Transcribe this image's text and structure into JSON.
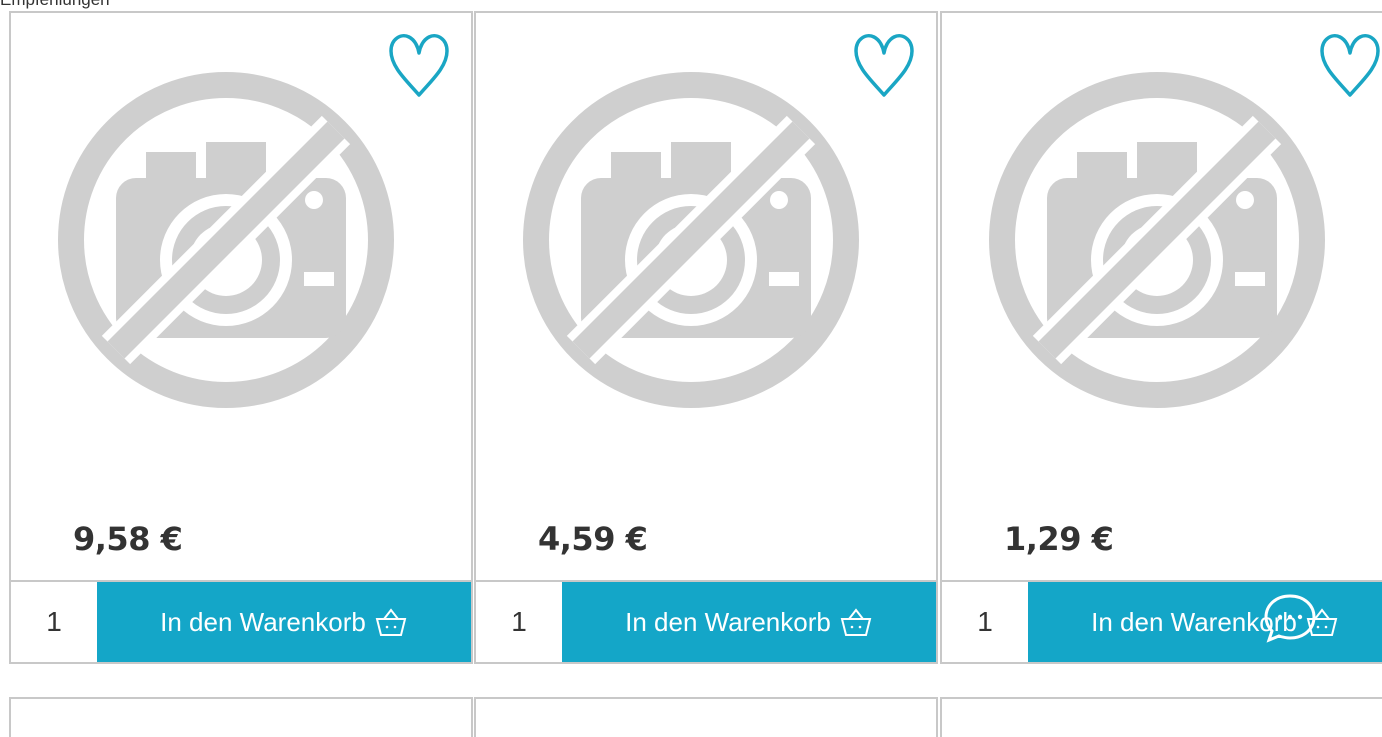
{
  "top_text": "Empfehlungen",
  "products": [
    {
      "price": "9,58 €",
      "qty": "1",
      "cart_label": "In den Warenkorb"
    },
    {
      "price": "4,59 €",
      "qty": "1",
      "cart_label": "In den Warenkorb"
    },
    {
      "price": "1,29 €",
      "qty": "1",
      "cart_label": "In den Warenkorb"
    }
  ],
  "colors": {
    "accent": "#14a6c8",
    "heart": "#1aa6c4",
    "placeholder": "#cfcfcf",
    "border": "#c8c8c8"
  },
  "icons": [
    "heart-icon",
    "no-image-icon",
    "basket-icon",
    "chat-icon"
  ]
}
